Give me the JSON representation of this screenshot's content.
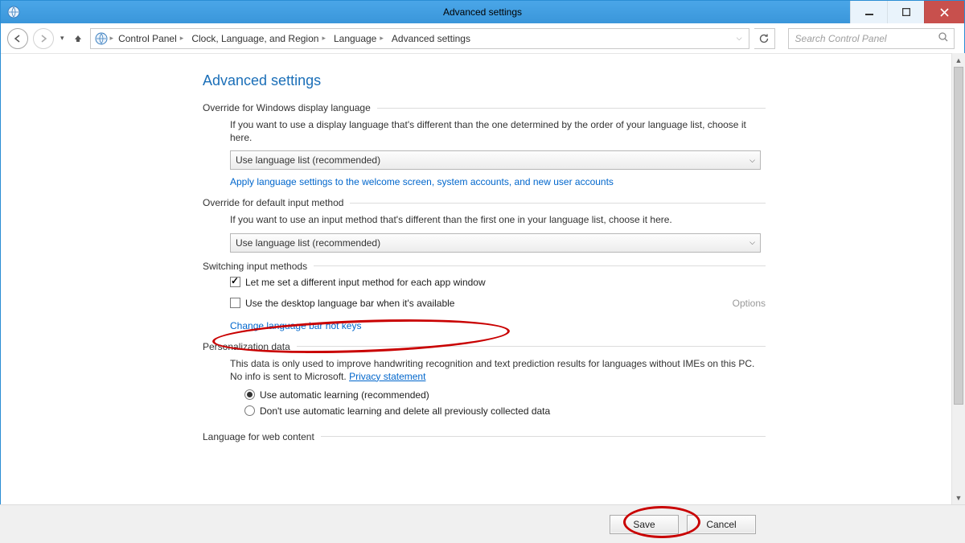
{
  "window": {
    "title": "Advanced settings"
  },
  "breadcrumb": {
    "items": [
      "Control Panel",
      "Clock, Language, and Region",
      "Language",
      "Advanced settings"
    ]
  },
  "search": {
    "placeholder": "Search Control Panel"
  },
  "page": {
    "title": "Advanced settings",
    "section1": {
      "title": "Override for Windows display language",
      "desc": "If you want to use a display language that's different than the one determined by the order of your language list, choose it here.",
      "combo": "Use language list (recommended)",
      "link": "Apply language settings to the welcome screen, system accounts, and new user accounts"
    },
    "section2": {
      "title": "Override for default input method",
      "desc": "If you want to use an input method that's different than the first one in your language list, choose it here.",
      "combo": "Use language list (recommended)"
    },
    "section3": {
      "title": "Switching input methods",
      "cb1": "Let me set a different input method for each app window",
      "cb2": "Use the desktop language bar when it's available",
      "options": "Options",
      "link": "Change language bar hot keys"
    },
    "section4": {
      "title": "Personalization data",
      "desc": "This data is only used to improve handwriting recognition and text prediction results for languages without IMEs on this PC. No info is sent to Microsoft. ",
      "privacy": "Privacy statement",
      "radio1": "Use automatic learning (recommended)",
      "radio2": "Don't use automatic learning and delete all previously collected data"
    },
    "section5": {
      "title": "Language for web content"
    }
  },
  "footer": {
    "save": "Save",
    "cancel": "Cancel"
  }
}
